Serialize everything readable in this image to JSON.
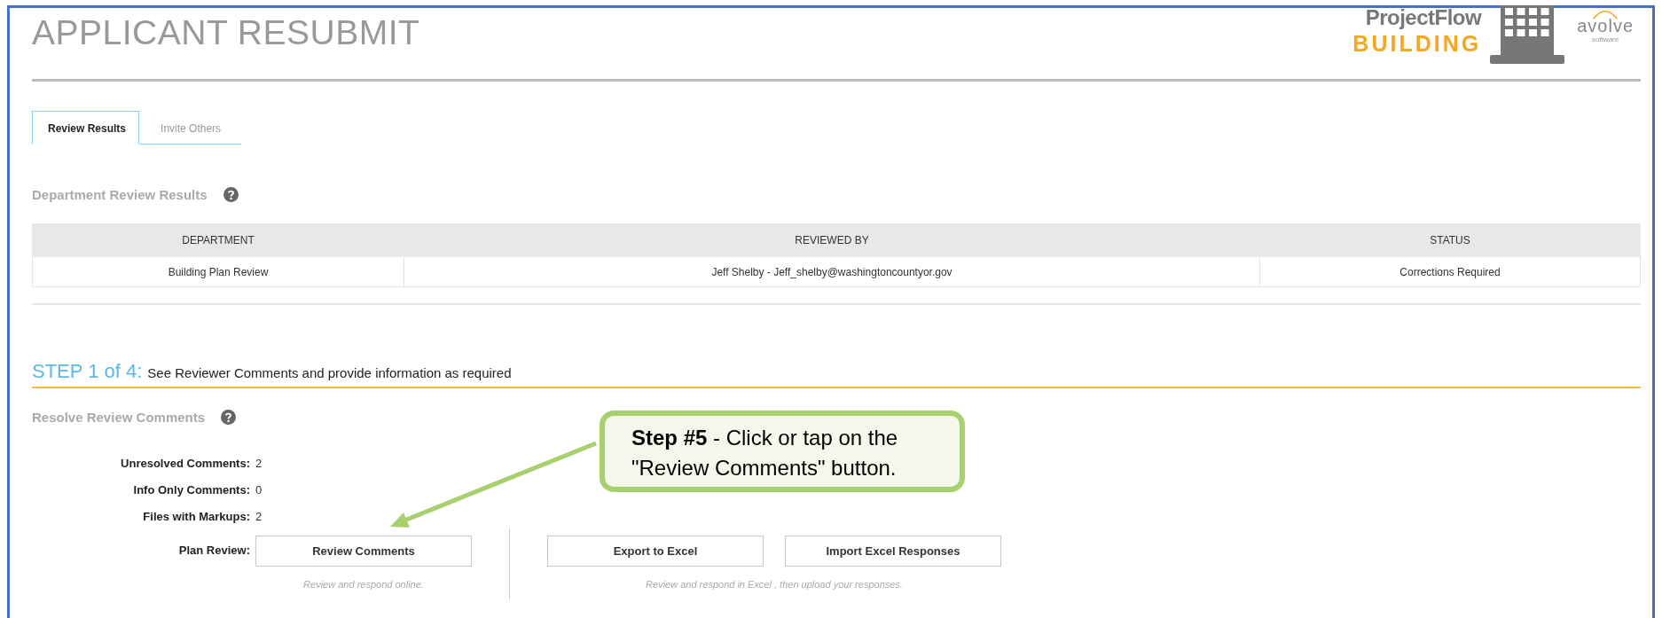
{
  "header": {
    "title": "APPLICANT RESUBMIT",
    "logo": {
      "product": "ProjectFlow",
      "subtitle": "BUILDING",
      "brand": "avolve",
      "brand_tag": "software"
    }
  },
  "tabs": [
    {
      "label": "Review Results",
      "selected": true
    },
    {
      "label": "Invite Others",
      "selected": false
    }
  ],
  "department_review": {
    "title": "Department Review Results",
    "table": {
      "columns": [
        "DEPARTMENT",
        "REVIEWED BY",
        "STATUS"
      ],
      "rows": [
        [
          "Building Plan Review",
          "Jeff Shelby - Jeff_shelby@washingtoncountyor.gov",
          "Corrections Required"
        ]
      ]
    }
  },
  "step": {
    "label": "STEP 1 of 4:",
    "description": "See Reviewer Comments and provide information as required"
  },
  "resolve": {
    "title": "Resolve Review Comments",
    "stats": [
      {
        "label": "Unresolved Comments:",
        "value": "2"
      },
      {
        "label": "Info Only Comments:",
        "value": "0"
      },
      {
        "label": "Files with Markups:",
        "value": "2"
      }
    ],
    "plan_review_label": "Plan Review:",
    "action_groups": [
      {
        "buttons": [
          "Review Comments"
        ],
        "hint": "Review and respond online."
      },
      {
        "buttons": [
          "Export to Excel",
          "Import Excel Responses"
        ],
        "hint": "Review and respond in Excel , then upload your responses."
      }
    ]
  },
  "callout": {
    "text": "**Step #5** - Click or tap on the \"Review Comments\" button."
  }
}
